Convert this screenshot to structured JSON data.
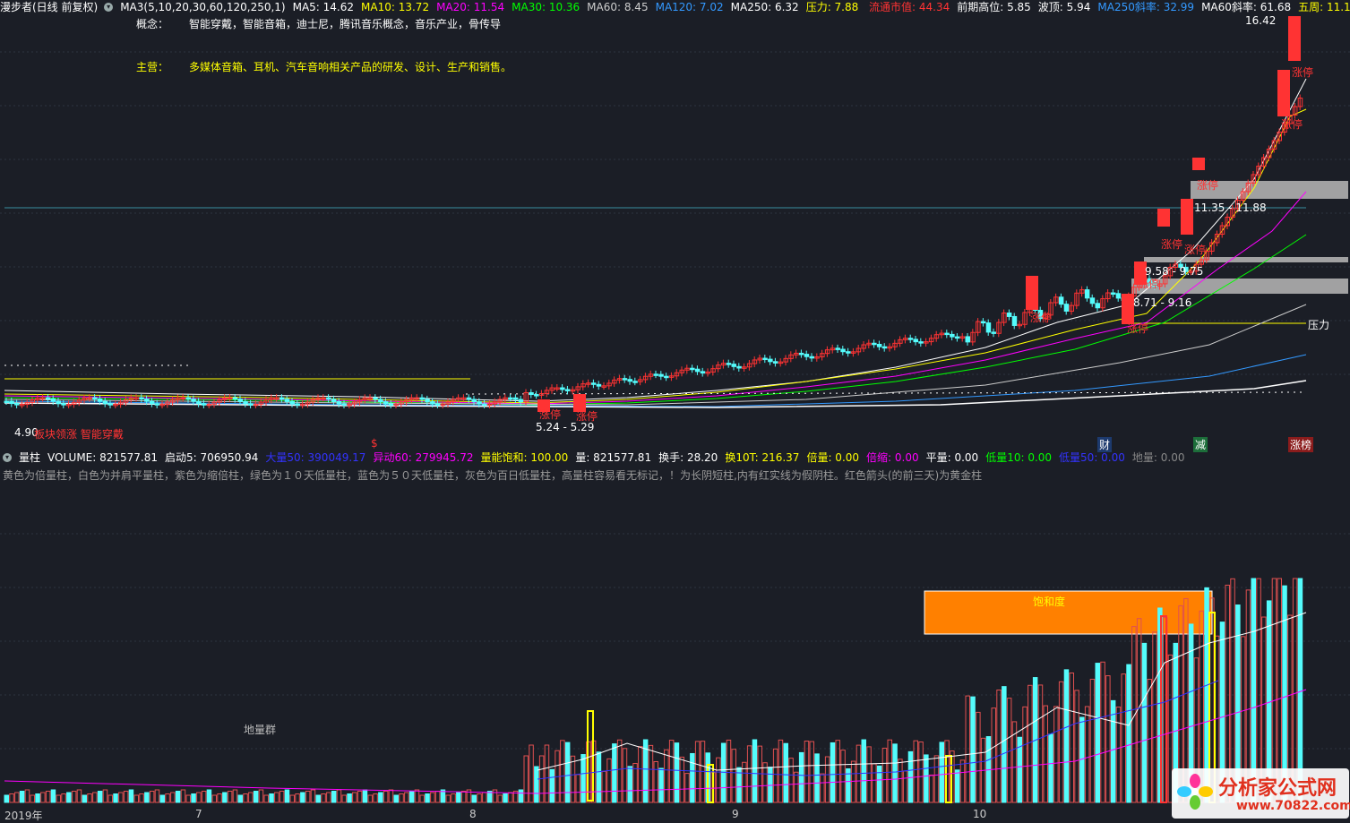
{
  "header": {
    "title": "漫步者(日线 前复权)",
    "ma_params": "MA3(5,10,20,30,60,120,250,1)",
    "ma_values": [
      {
        "text": "MA5: 14.62",
        "color": "#ffffff"
      },
      {
        "text": "MA10: 13.72",
        "color": "#ffff00"
      },
      {
        "text": "MA20: 11.54",
        "color": "#ff00ff"
      },
      {
        "text": "MA30: 10.36",
        "color": "#00ff00"
      },
      {
        "text": "MA60: 8.45",
        "color": "#cccccc"
      },
      {
        "text": "MA120: 7.02",
        "color": "#3399ff"
      },
      {
        "text": "MA250: 6.32",
        "color": "#ffffff"
      },
      {
        "text": "压力: 7.88",
        "color": "#ffff00"
      }
    ],
    "right_items": [
      {
        "text": "流通市值: 44.34",
        "color": "#ff3333"
      },
      {
        "text": "前期高位: 5.85",
        "color": "#ffffff"
      },
      {
        "text": "波顶: 5.94",
        "color": "#ffffff"
      },
      {
        "text": "MA250斜率: 32.99",
        "color": "#3399ff"
      },
      {
        "text": "MA60斜率: 61.68",
        "color": "#ffffff"
      },
      {
        "text": "五周: 11.1",
        "color": "#ffff00"
      }
    ]
  },
  "info": {
    "concept_label": "概念：",
    "concept_text": "智能穿戴，智能音箱，迪士尼，腾讯音乐概念，音乐产业，骨传导",
    "main_label": "主营：",
    "main_text": "多媒体音箱、耳机、汽车音响相关产品的研发、设计、生产和销售。"
  },
  "price_labels": {
    "high": "16.42",
    "low_left": "4.90",
    "range_bottom": "5.24 - 5.29",
    "range1": "11.35 - 11.88",
    "range2": "9.58 - 9.75",
    "range3": "8.71 - 9.16",
    "pressure": "压力",
    "limit_up": "涨停",
    "left_tags": "板块领涨 智能穿戴",
    "dollar": "$",
    "tag_cai": "财",
    "tag_jian": "减",
    "tag_zhangbang": "涨榜"
  },
  "volume_header": [
    {
      "text": "量柱",
      "color": "#ffffff"
    },
    {
      "text": "VOLUME: 821577.81",
      "color": "#ffffff"
    },
    {
      "text": "启动5: 706950.94",
      "color": "#ffffff"
    },
    {
      "text": "大量50: 390049.17",
      "color": "#3333ff"
    },
    {
      "text": "异动60: 279945.72",
      "color": "#ff00ff"
    },
    {
      "text": "量能饱和: 100.00",
      "color": "#ffff00"
    },
    {
      "text": "量: 821577.81",
      "color": "#ffffff"
    },
    {
      "text": "换手: 28.20",
      "color": "#ffffff"
    },
    {
      "text": "换10T: 216.37",
      "color": "#ffff00"
    },
    {
      "text": "倍量: 0.00",
      "color": "#ffff00"
    },
    {
      "text": "倍缩: 0.00",
      "color": "#ff00ff"
    },
    {
      "text": "平量: 0.00",
      "color": "#ffffff"
    },
    {
      "text": "低量10: 0.00",
      "color": "#00ff00"
    },
    {
      "text": "低量50: 0.00",
      "color": "#3333ff"
    },
    {
      "text": "地量: 0.00",
      "color": "#888888"
    }
  ],
  "volume_note": "黄色为倍量柱，白色为并肩平量柱，紫色为缩倍柱，绿色为１０天低量柱，蓝色为５０天低量柱，灰色为百日低量柱，高量柱容易看无标记，！为长阴短柱,内有红实线为假阴柱。红色箭头(的前三天)为黄金柱",
  "saturation_label": "饱和度",
  "low_group_label": "地量群",
  "x_axis": [
    "2019年",
    "7",
    "8",
    "9",
    "10"
  ],
  "watermark": {
    "text": "分析家公式网",
    "url": "www.70822.com"
  },
  "colors": {
    "up": "#ff3333",
    "down": "#54fcfc",
    "bg": "#1b1e26"
  }
}
